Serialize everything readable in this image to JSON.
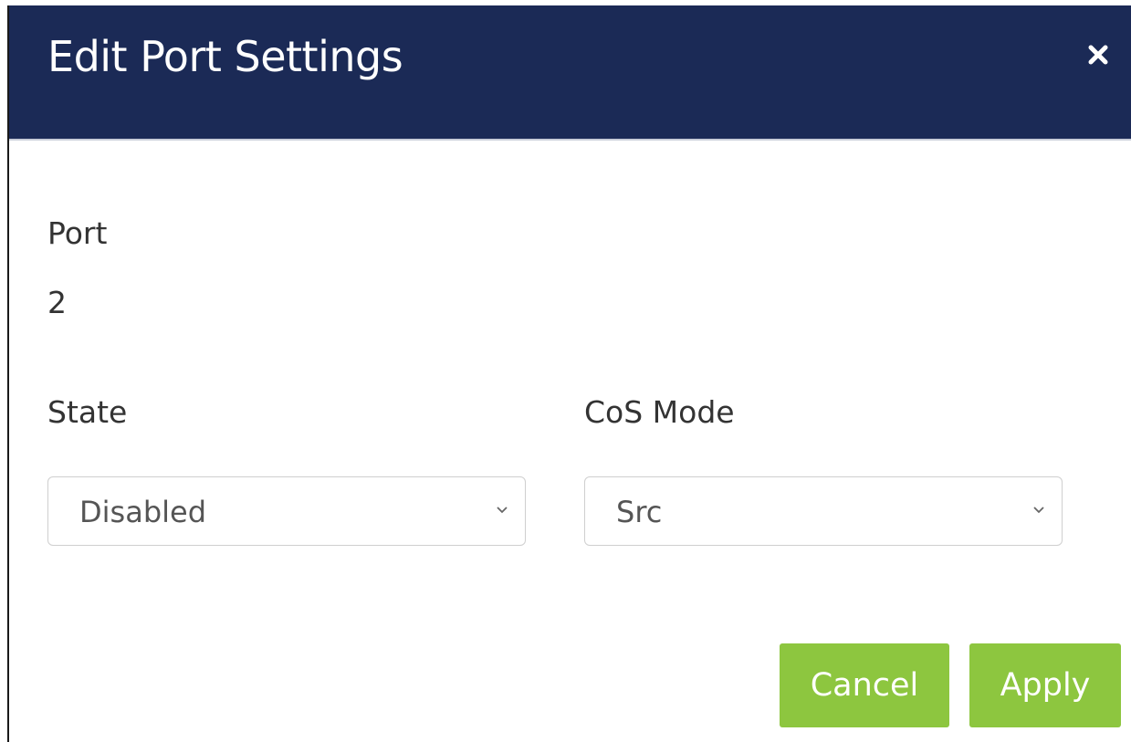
{
  "dialog": {
    "title": "Edit Port Settings",
    "close_icon": "close-icon",
    "colors": {
      "header_bg": "#1b2a56",
      "button_bg": "#8dc63f"
    }
  },
  "port": {
    "label": "Port",
    "value": "2"
  },
  "state": {
    "label": "State",
    "selected": "Disabled",
    "icon": "chevron-down-icon"
  },
  "cos_mode": {
    "label": "CoS Mode",
    "selected": "Src",
    "icon": "chevron-down-icon"
  },
  "actions": {
    "cancel_label": "Cancel",
    "apply_label": "Apply"
  }
}
